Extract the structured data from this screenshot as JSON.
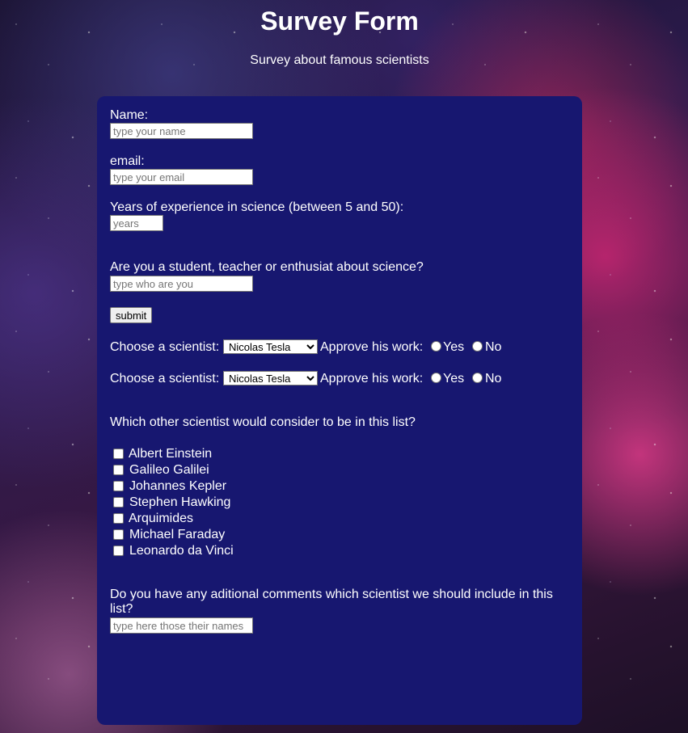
{
  "title": "Survey Form",
  "subtitle": "Survey about famous scientists",
  "form": {
    "name_label": "Name:",
    "name_placeholder": "type your name",
    "email_label": "email:",
    "email_placeholder": "type your email",
    "years_label": "Years of experience in science (between 5 and 50):",
    "years_placeholder": "years",
    "role_label": "Are you a student, teacher or enthusiat about science?",
    "role_placeholder": "type who are you",
    "submit_label": "submit",
    "scientist_rows": [
      {
        "choose_label": "Choose a scientist:",
        "selected": "Nicolas Tesla",
        "approve_label": "Approve his work:",
        "yes": "Yes",
        "no": "No"
      },
      {
        "choose_label": "Choose a scientist:",
        "selected": "Nicolas Tesla",
        "approve_label": "Approve his work:",
        "yes": "Yes",
        "no": "No"
      }
    ],
    "other_question": "Which other scientist would consider to be in this list?",
    "scientists": [
      "Albert Einstein",
      "Galileo Galilei",
      "Johannes Kepler",
      "Stephen Hawking",
      "Arquimides",
      "Michael Faraday",
      "Leonardo da Vinci"
    ],
    "comments_label": "Do you have any aditional comments which scientist we should include in this list?",
    "comments_placeholder": "type here those their names"
  },
  "colors": {
    "card": "#171770"
  }
}
